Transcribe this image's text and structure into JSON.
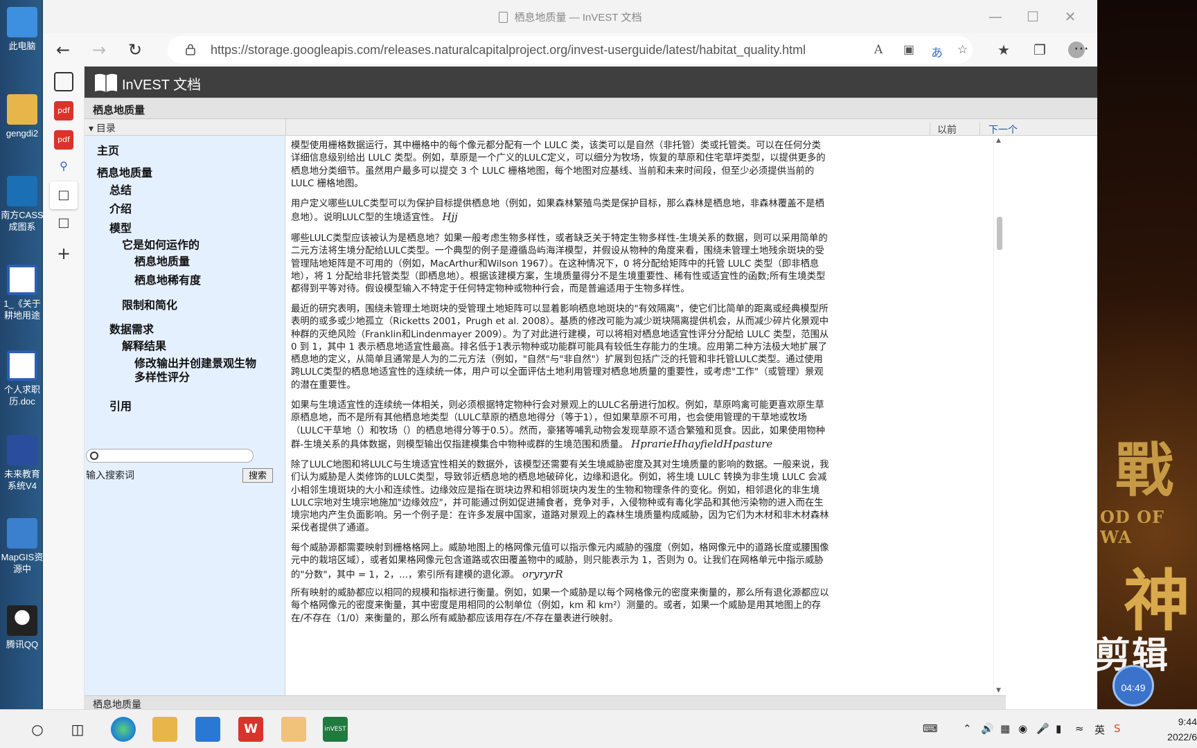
{
  "desktop": {
    "icons": [
      {
        "label": "此电脑",
        "color": "#3d8fe0"
      },
      {
        "label": "gengdi2",
        "color": "#e8b54a"
      },
      {
        "label": "南方CASS成图系",
        "color": "#1b6fb5"
      },
      {
        "label": "1_《关于耕地用途",
        "color": "#2b5fb3"
      },
      {
        "label": "个人求职历.doc",
        "color": "#2b5fb3"
      },
      {
        "label": "未来教育系统V4",
        "color": "#2b4d9e"
      },
      {
        "label": "MapGIS资源中",
        "color": "#3b7fcf"
      },
      {
        "label": "腾讯QQ",
        "color": "#222222"
      }
    ],
    "wallpaper_text": [
      "戰",
      "OD OF WA",
      "神"
    ]
  },
  "browser": {
    "window_title": "栖息地质量 — InVEST 文档",
    "url": "https://storage.googleapis.com/releases.naturalcapitalproject.org/invest-userguide/latest/habitat_quality.html",
    "read_aloud": "A",
    "translate": "あ"
  },
  "page": {
    "brand": "InVEST 文档",
    "page_title": "栖息地质量",
    "toc_toggle": "▾ 目录",
    "prev_label": "以前",
    "next_label": "下一个",
    "footer_title": "栖息地质量"
  },
  "sidebar": {
    "items": [
      {
        "label": "主页"
      },
      {
        "label": "栖息地质量"
      },
      {
        "label": "总结"
      },
      {
        "label": "介绍"
      },
      {
        "label": "模型"
      },
      {
        "label": "它是如何运作的"
      },
      {
        "label": "栖息地质量"
      },
      {
        "label": "栖息地稀有度"
      },
      {
        "label": "限制和简化"
      },
      {
        "label": "数据需求"
      },
      {
        "label": "解释结果"
      },
      {
        "label": "修改输出并创建景观生物多样性评分"
      },
      {
        "label": "引用"
      }
    ],
    "search_hint": "输入搜索词",
    "search_button": "搜索"
  },
  "content": {
    "p1": "模型使用栅格数据运行，其中栅格中的每个像元都分配有一个 LULC 类，该类可以是自然（非托管）类或托管类。可以在任何分类详细信息级别给出 LULC 类型。例如，草原是一个广义的LULC定义，可以细分为牧场，恢复的草原和住宅草坪类型，以提供更多的栖息地分类细节。虽然用户最多可以提交 3 个 LULC 栅格地图，每个地图对应基线、当前和未来时间段，但至少必须提供当前的 LULC 栅格地图。",
    "p2": "用户定义哪些LULC类型可以为保护目标提供栖息地（例如，如果森林繁殖鸟类是保护目标，那么森林是栖息地，非森林覆盖不是栖息地）。说明LULC型的生境适宜性。",
    "p2_math": "Hjj",
    "p3": "哪些LULC类型应该被认为是栖息地？如果一般考虑生物多样性，或者缺乏关于特定生物多样性-生境关系的数据，则可以采用简单的二元方法将生境分配给LULC类型。一个典型的例子是遵循岛屿海洋模型，并假设从物种的角度来看，围绕未管理土地残余斑块的受管理陆地矩阵是不可用的（例如，MacArthur和Wilson 1967）。在这种情况下，0 将分配给矩阵中的托管 LULC 类型（即非栖息地），将 1 分配给非托管类型（即栖息地）。根据该建模方案，生境质量得分不是生境重要性、稀有性或适宜性的函数;所有生境类型都得到平等对待。假设模型输入不特定于任何特定物种或物种行会，而是普遍适用于生物多样性。",
    "p4": "最近的研究表明，围绕未管理土地斑块的受管理土地矩阵可以显着影响栖息地斑块的\"有效隔离\"，使它们比简单的距离或经典模型所表明的或多或少地孤立（Ricketts 2001，Prugh et al. 2008）。基质的修改可能为减少斑块隔离提供机会，从而减少碎片化景观中种群的灭绝风险（Franklin和Lindenmayer 2009）。为了对此进行建模，可以将相对栖息地适宜性评分分配给 LULC 类型，范围从 0 到 1，其中 1 表示栖息地适宜性最高。排名低于1表示物种或功能群可能具有较低生存能力的生境。应用第二种方法极大地扩展了栖息地的定义，从简单且通常是人为的二元方法（例如，\"自然\"与\"非自然\"）扩展到包括广泛的托管和非托管LULC类型。通过使用跨LULC类型的栖息地适宜性的连续统一体，用户可以全面评估土地利用管理对栖息地质量的重要性，或考虑\"工作\"（或管理）景观的潜在重要性。",
    "p5": "如果与生境适宜性的连续统一体相关，则必须根据特定物种行会对景观上的LULC名册进行加权。例如，草原鸣禽可能更喜欢原生草原栖息地，而不是所有其他栖息地类型（LULC草原的栖息地得分（等于1），但如果草原不可用，也会使用管理的干草地或牧场（LULC干草地（）和牧场（）的栖息地得分等于0.5）。然而，豪猪等哺乳动物会发现草原不适合繁殖和觅食。因此，如果使用物种群-生境关系的具体数据，则模型输出仅指建模集合中物种或群的生境范围和质量。",
    "p5_math": "HprarieHhayfieldHpasture",
    "p6": "除了LULC地图和将LULC与生境适宜性相关的数据外，该模型还需要有关生境威胁密度及其对生境质量的影响的数据。一般来说，我们认为威胁是人类修饰的LULC类型，导致邻近栖息地的栖息地破碎化，边缘和退化。例如，将生境 LULC 转换为非生境 LULC 会减小相邻生境斑块的大小和连续性。边缘效应是指在斑块边界和相邻斑块内发生的生物和物理条件的变化。例如，相邻退化的非生境LULC宗地对生境宗地施加\"边缘效应\"，并可能通过例如促进捕食者，竞争对手，入侵物种或有毒化学品和其他污染物的进入而在生境宗地内产生负面影响。另一个例子是：在许多发展中国家，道路对景观上的森林生境质量构成威胁，因为它们为木材和非木材森林采伐者提供了通道。",
    "p7": "每个威胁源都需要映射到栅格格网上。威胁地图上的格网像元值可以指示像元内威胁的强度（例如，格网像元中的道路长度或腰围像元中的栽培区域），或者如果格网像元包含道路或农田覆盖物中的威胁，则只能表示为 1，否则为 0。让我们在网格单元中指示威胁的\"分数\"，其中 = 1，2，...，索引所有建模的退化源。",
    "p7_math": "oryryrR",
    "p8": "所有映射的威胁都应以相同的规模和指标进行衡量。例如，如果一个威胁是以每个网格像元的密度来衡量的，那么所有退化源都应以每个格网像元的密度来衡量，其中密度是用相同的公制单位（例如，km 和 km²）测量的。或者，如果一个威胁是用其地图上的存在/不存在（1/0）来衡量的，那么所有威胁都应该用存在/不存在量表进行映射。"
  },
  "overlay": {
    "clock": "04:49",
    "watermark": "剪辑"
  },
  "taskbar": {
    "time": "9:44",
    "date": "2022/6",
    "ime": "英"
  }
}
